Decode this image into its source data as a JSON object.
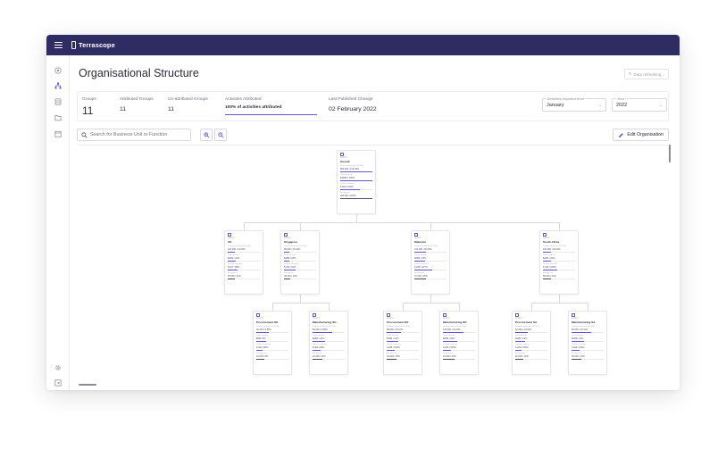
{
  "app": {
    "brand": "Terrascope"
  },
  "page": {
    "title": "Organisational Structure",
    "refresh_label": "Data refreshing..."
  },
  "stats": {
    "groups_label": "Groups",
    "groups_value": "11",
    "attributed_label": "Attributed Groups",
    "attributed_value": "11",
    "unattributed_label": "Un-attributed Groups",
    "unattributed_value": "11",
    "activities_label": "Activities Attributed",
    "activities_value": "100% of activities attributed",
    "published_label": "Last Published Change",
    "published_value": "02 February 2022"
  },
  "filters": {
    "from_label": "Activities reported from",
    "from_value": "January",
    "year_label": "Year",
    "year_value": "2022"
  },
  "search": {
    "placeholder": "Search for Business Unit or Function"
  },
  "toolbar": {
    "edit_label": "Edit Organisation"
  },
  "colors": {
    "topbar": "#2f2c63",
    "accent": "#6b4fd1"
  },
  "sidebar_icons": [
    "dashboard-icon",
    "org-structure-icon",
    "database-icon",
    "folder-icon",
    "calendar-icon",
    "settings-icon",
    "logout-icon"
  ],
  "org_tree": [
    {
      "id": "root",
      "level": "Level 1",
      "name": "Overall",
      "metrics": [
        {
          "label": "Carbon emissions (tCO2e)",
          "value": "584,000 | 100.00%",
          "pct": 100
        },
        {
          "label": "Total revenue",
          "value": "$100M | 100%",
          "pct": 100
        },
        {
          "label": "Carbon intensity",
          "value": "5,840 | 100%",
          "pct": 60
        },
        {
          "label": "Energy use",
          "value": "205,000 | 100%",
          "pct": 100
        }
      ]
    },
    {
      "id": "uk",
      "level": "Level 2",
      "name": "UK",
      "metrics": [
        {
          "label": "Carbon emissions (tCO2e)",
          "value": "124,000 | 21.23%",
          "pct": 21
        },
        {
          "label": "Total revenue",
          "value": "$24M | 24%",
          "pct": 24
        },
        {
          "label": "Carbon intensity",
          "value": "5,167 | 88%",
          "pct": 30
        },
        {
          "label": "Energy use",
          "value": "45,000 | 22%",
          "pct": 22
        }
      ]
    },
    {
      "id": "singapore",
      "level": "Level 2",
      "name": "Singapore",
      "metrics": [
        {
          "label": "Carbon emissions (tCO2e)",
          "value": "96,000 | 16.44%",
          "pct": 16
        },
        {
          "label": "Total revenue",
          "value": "$18M | 18%",
          "pct": 18
        },
        {
          "label": "Carbon intensity",
          "value": "5,333 | 91%",
          "pct": 35
        },
        {
          "label": "Energy use",
          "value": "38,000 | 19%",
          "pct": 19
        }
      ]
    },
    {
      "id": "malaysia",
      "level": "Level 2",
      "name": "Malaysia",
      "metrics": [
        {
          "label": "Carbon emissions (tCO2e)",
          "value": "212,000 | 36.30%",
          "pct": 36
        },
        {
          "label": "Total revenue",
          "value": "$34M | 34%",
          "pct": 34
        },
        {
          "label": "Carbon intensity",
          "value": "6,235 | 107%",
          "pct": 55
        },
        {
          "label": "Energy use",
          "value": "72,000 | 35%",
          "pct": 35
        }
      ]
    },
    {
      "id": "southafrica",
      "level": "Level 2",
      "name": "South Africa",
      "metrics": [
        {
          "label": "Carbon emissions (tCO2e)",
          "value": "152,000 | 26.03%",
          "pct": 26
        },
        {
          "label": "Total revenue",
          "value": "$24M | 24%",
          "pct": 24
        },
        {
          "label": "Carbon intensity",
          "value": "6,333 | 108%",
          "pct": 45
        },
        {
          "label": "Energy use",
          "value": "50,000 | 24%",
          "pct": 24
        }
      ]
    },
    {
      "id": "proc-sg",
      "level": "Level 3",
      "name": "Procurement SG",
      "metrics": [
        {
          "label": "Carbon emissions (tCO2e)",
          "value": "40,000 | 6.85%",
          "pct": 40
        },
        {
          "label": "Total revenue",
          "value": "$8M | 8%",
          "pct": 30
        },
        {
          "label": "Carbon intensity",
          "value": "5,000 | 86%",
          "pct": 20
        },
        {
          "label": "Energy use",
          "value": "16,000 | 8%",
          "pct": 25
        }
      ]
    },
    {
      "id": "mfg-sg",
      "level": "Level 3",
      "name": "Manufacturing SG",
      "metrics": [
        {
          "label": "Carbon emissions (tCO2e)",
          "value": "56,000 | 9.59%",
          "pct": 60
        },
        {
          "label": "Total revenue",
          "value": "$10M | 10%",
          "pct": 40
        },
        {
          "label": "Carbon intensity",
          "value": "5,600 | 96%",
          "pct": 25
        },
        {
          "label": "Energy use",
          "value": "22,000 | 11%",
          "pct": 30
        }
      ]
    },
    {
      "id": "proc-my",
      "level": "Level 3",
      "name": "Procurement MY",
      "metrics": [
        {
          "label": "Carbon emissions (tCO2e)",
          "value": "88,000 | 15.07%",
          "pct": 45
        },
        {
          "label": "Total revenue",
          "value": "$14M | 14%",
          "pct": 35
        },
        {
          "label": "Carbon intensity",
          "value": "6,286 | 108%",
          "pct": 25
        },
        {
          "label": "Energy use",
          "value": "30,000 | 15%",
          "pct": 30
        }
      ]
    },
    {
      "id": "mfg-my",
      "level": "Level 3",
      "name": "Manufacturing MY",
      "metrics": [
        {
          "label": "Carbon emissions (tCO2e)",
          "value": "124,000 | 21.23%",
          "pct": 65
        },
        {
          "label": "Total revenue",
          "value": "$20M | 20%",
          "pct": 45
        },
        {
          "label": "Carbon intensity",
          "value": "6,200 | 106%",
          "pct": 25
        },
        {
          "label": "Energy use",
          "value": "42,000 | 20%",
          "pct": 35
        }
      ]
    },
    {
      "id": "proc-sa",
      "level": "Level 3",
      "name": "Procurement SA",
      "metrics": [
        {
          "label": "Carbon emissions (tCO2e)",
          "value": "62,000 | 10.62%",
          "pct": 40
        },
        {
          "label": "Total revenue",
          "value": "$10M | 10%",
          "pct": 30
        },
        {
          "label": "Carbon intensity",
          "value": "6,200 | 106%",
          "pct": 20
        },
        {
          "label": "Energy use",
          "value": "20,000 | 10%",
          "pct": 25
        }
      ]
    },
    {
      "id": "mfg-sa",
      "level": "Level 3",
      "name": "Manufacturing SA",
      "metrics": [
        {
          "label": "Carbon emissions (tCO2e)",
          "value": "90,000 | 15.41%",
          "pct": 60
        },
        {
          "label": "Total revenue",
          "value": "$14M | 14%",
          "pct": 40
        },
        {
          "label": "Carbon intensity",
          "value": "6,429 | 110%",
          "pct": 25
        },
        {
          "label": "Energy use",
          "value": "30,000 | 14%",
          "pct": 30
        }
      ]
    }
  ]
}
